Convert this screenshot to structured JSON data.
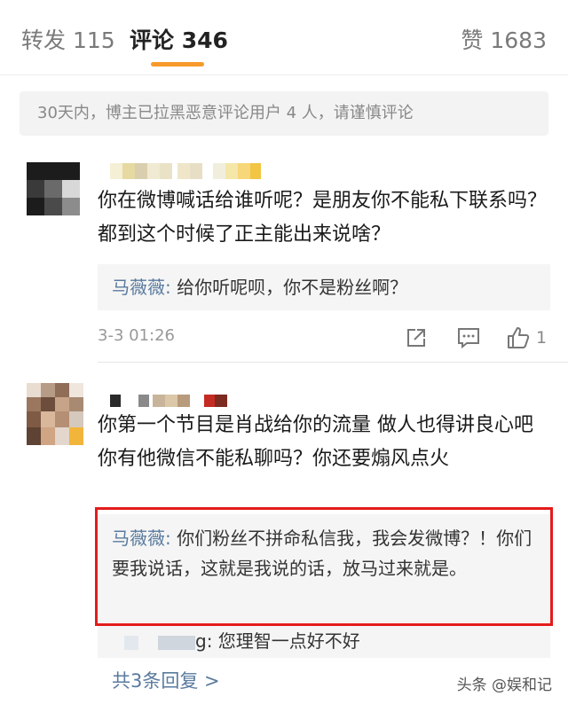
{
  "tabs": {
    "repost": "转发 115",
    "comments": "评论 346",
    "likes": "赞 1683"
  },
  "notice": "30天内，博主已拉黑恶意评论用户 4 人，请谨慎评论",
  "comments": [
    {
      "text": "你在微博喊话给谁听呢？是朋友你不能私下联系吗？都到这个时候了正主能出来说啥？",
      "reply": {
        "name": "马薇薇",
        "colon": ": ",
        "text": "给你听呢呗，你不是粉丝啊？"
      },
      "time": "3-3 01:26",
      "like_count": "1"
    },
    {
      "text": "你第一个节目是肖战给你的流量 做人也得讲良心吧 你有他微信不能私聊吗？你还要煽风点火",
      "reply": {
        "name": "马薇薇",
        "colon": ": ",
        "text": "你们粉丝不拼命私信我，我会发微博？！你们要我说话，这就是我说的话，放马过来就是。"
      },
      "second_reply_text": "g: 您理智一点好不好",
      "more_replies": "共3条回复 >"
    }
  ],
  "watermark": "头条 @娱和记",
  "colors": {
    "accent": "#f79a2b",
    "link": "#5a7b9e",
    "highlight_frame": "#e31b1b"
  }
}
